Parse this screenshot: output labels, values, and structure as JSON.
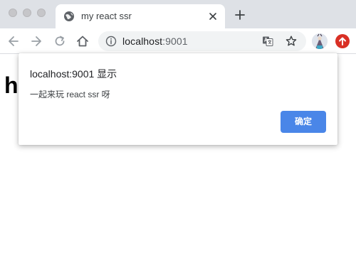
{
  "browser": {
    "tab": {
      "title": "my react ssr"
    },
    "address_bar": {
      "host": "localhost",
      "port": ":9001"
    }
  },
  "page": {
    "heading_visible": "h"
  },
  "dialog": {
    "title": "localhost:9001 显示",
    "message": "一起来玩 react ssr 呀",
    "ok_label": "确定"
  },
  "colors": {
    "accent": "#4a86e8",
    "tabstrip": "#dee1e6",
    "update_badge": "#d93025"
  }
}
